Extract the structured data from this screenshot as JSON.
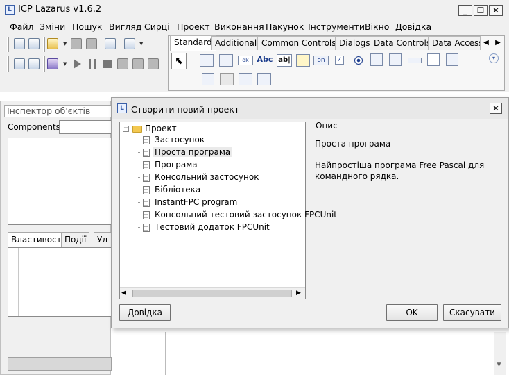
{
  "main_window": {
    "title": "ICP Lazarus v1.6.2",
    "controls": {
      "minimize": "_",
      "maximize": "☐",
      "close": "✕"
    }
  },
  "menu": [
    "Файл",
    "Зміни",
    "Пошук",
    "Вигляд",
    "Сирці",
    "Проект",
    "Виконання",
    "Пакунок",
    "Інструменти",
    "Вікно",
    "Довідка"
  ],
  "palette": {
    "tabs": [
      "Standard",
      "Additional",
      "Common Controls",
      "Dialogs",
      "Data Controls",
      "Data Access"
    ],
    "scroll_left": "◀",
    "scroll_right": "▶",
    "components": [
      "arrow",
      "TMainMenu",
      "TPopupMenu",
      "TButton",
      "TLabel",
      "TEdit",
      "TMemo",
      "TToggleBox",
      "TCheckBox",
      "TRadioButton",
      "TListBox",
      "TComboBox",
      "TScrollBar",
      "TGroupBox",
      "TRadioGroup",
      "TCheckGroup",
      "TPanel",
      "TFrame",
      "TActionList"
    ],
    "button_glyph": "ok",
    "label_glyph": "Abc",
    "edit_glyph": "ab|",
    "toggle_glyph": "on",
    "expand_icon": "chevron-down-icon"
  },
  "inspector": {
    "title": "Інспектор об'єктів",
    "components_label": "Components",
    "tabs": [
      "Властивості",
      "Події",
      "Ул"
    ]
  },
  "dialog": {
    "title": "Створити новий проект",
    "tree": {
      "root": "Проект",
      "root_expander": "−",
      "items": [
        "Застосунок",
        "Проста програма",
        "Програма",
        "Консольний застосунок",
        "Бібліотека",
        "InstantFPC program",
        "Консольний тестовий застосунок FPCUnit",
        "Тестовий додаток FPCUnit"
      ],
      "selected_index": 1
    },
    "description": {
      "legend": "Опис",
      "title": "Проста програма",
      "text": "Найпростіша програма Free Pascal для командного рядка."
    },
    "buttons": {
      "help": "Довідка",
      "ok": "OK",
      "cancel": "Скасувати"
    },
    "scroll_left": "◀",
    "scroll_right": "▶",
    "close": "✕"
  }
}
